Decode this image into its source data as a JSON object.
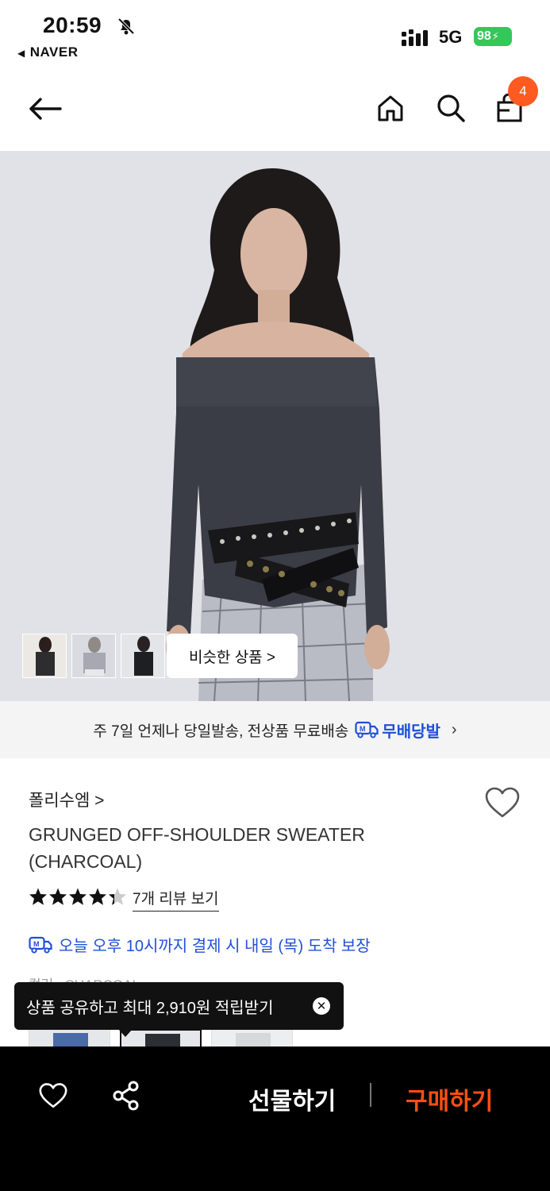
{
  "status_bar": {
    "time": "20:59",
    "back_app": "NAVER",
    "network": "5G",
    "battery": "98"
  },
  "nav": {
    "cart_count": "4"
  },
  "gallery": {
    "similar_button": "비슷한 상품 >"
  },
  "shipping_banner": {
    "text": "주 7일 언제나 당일발송, 전상품 무료배송",
    "badge": "무배당발"
  },
  "product": {
    "brand": "폴리수엠 >",
    "title": "GRUNGED OFF-SHOULDER SWEATER (CHARCOAL)",
    "rating_stars": 4.5,
    "reviews_link": "7개 리뷰 보기",
    "delivery_promise": "오늘 오후 10시까지 결제 시 내일 (목) 도착 보장",
    "option_label": "컬러 : CHARCOAL"
  },
  "tooltip": {
    "text": "상품 공유하고 최대 2,910원 적립받기"
  },
  "bottom_bar": {
    "gift_label": "선물하기",
    "buy_label": "구매하기"
  },
  "colors": {
    "accent_orange": "#ff4f12",
    "badge_orange": "#ff5a1f",
    "link_blue": "#1f4fd6",
    "battery_green": "#34c759"
  }
}
